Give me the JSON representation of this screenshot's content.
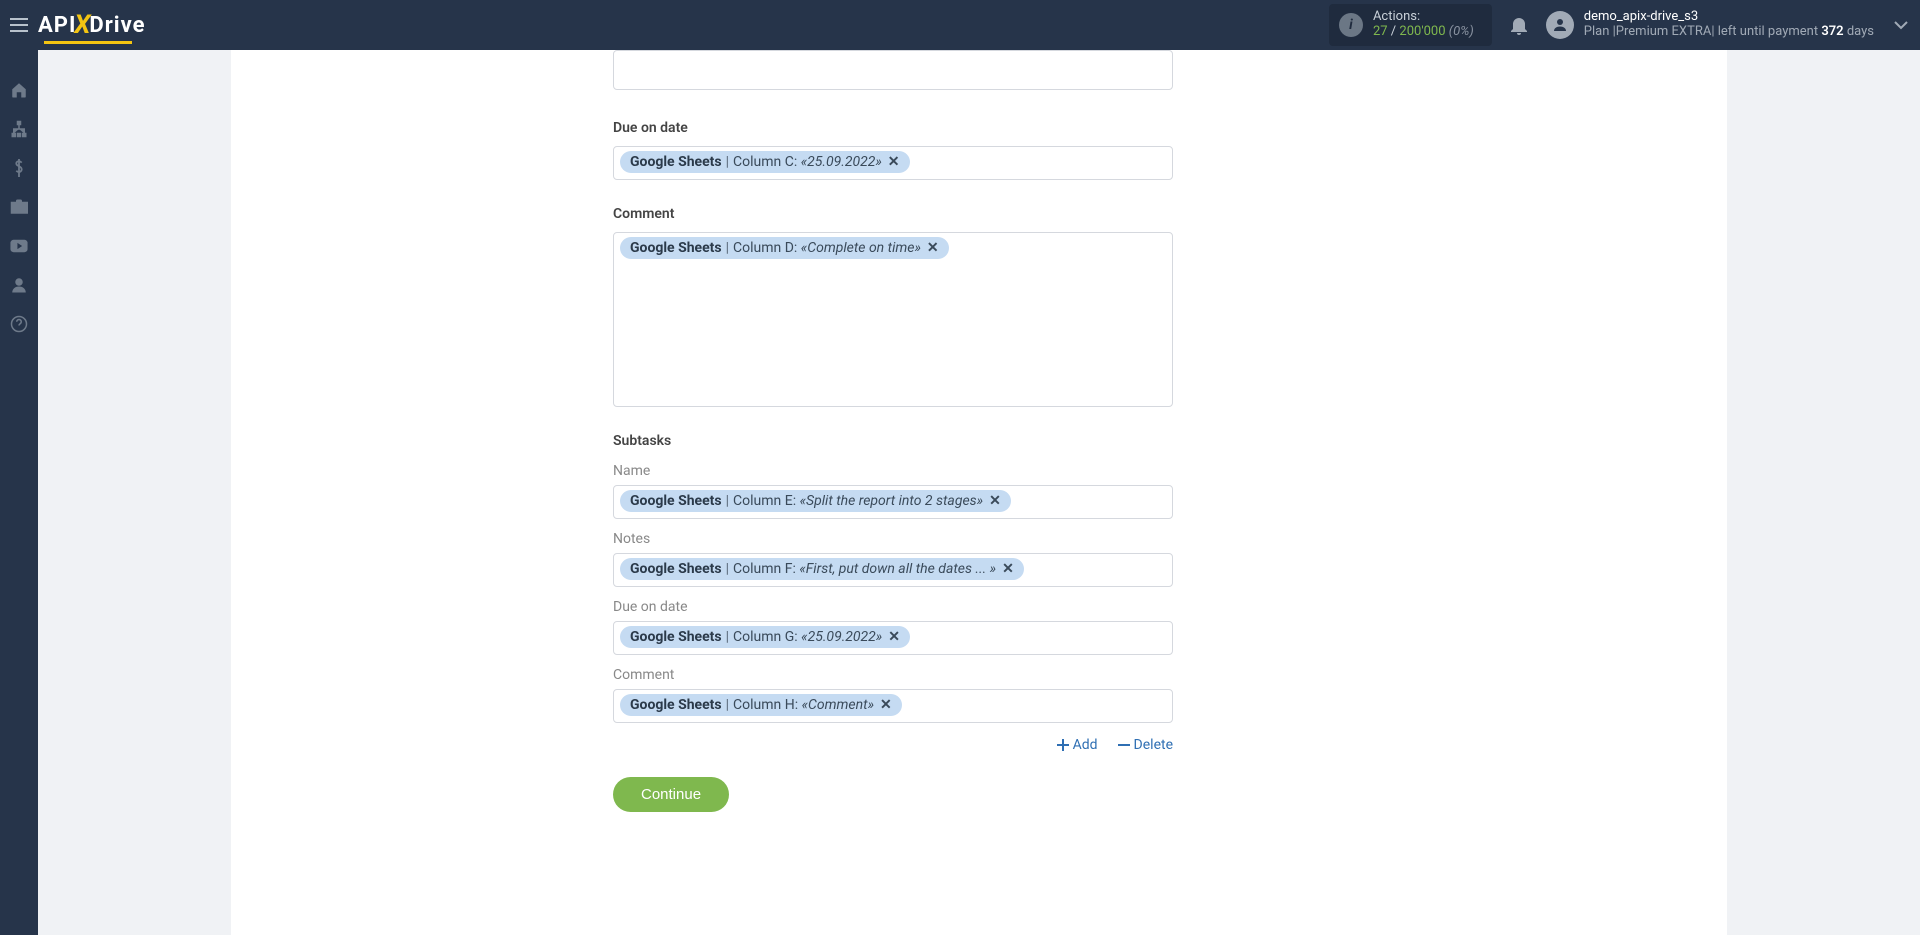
{
  "header": {
    "logo_left": "API",
    "logo_x": "X",
    "logo_right": "Drive",
    "actions_label": "Actions:",
    "actions_count": "27",
    "actions_of": " / ",
    "actions_limit": "200'000",
    "actions_pct": "(0%)",
    "user_name": "demo_apix-drive_s3",
    "plan_prefix": "Plan |",
    "plan_name": "Premium EXTRA",
    "plan_mid": "| left until payment ",
    "plan_days": "372",
    "plan_suffix": " days"
  },
  "fields": {
    "due_on_date": {
      "label": "Due on date",
      "tag": {
        "source": "Google Sheets",
        "column": "Column C:",
        "sample": "«25.09.2022»"
      }
    },
    "comment": {
      "label": "Comment",
      "tag": {
        "source": "Google Sheets",
        "column": "Column D:",
        "sample": "«Complete on time»"
      }
    },
    "subtasks_header": "Subtasks",
    "sub_name": {
      "label": "Name",
      "tag": {
        "source": "Google Sheets",
        "column": "Column E:",
        "sample": "«Split the report into 2 stages»"
      }
    },
    "sub_notes": {
      "label": "Notes",
      "tag": {
        "source": "Google Sheets",
        "column": "Column F:",
        "sample": "«First, put down all the dates ... »"
      }
    },
    "sub_due": {
      "label": "Due on date",
      "tag": {
        "source": "Google Sheets",
        "column": "Column G:",
        "sample": "«25.09.2022»"
      }
    },
    "sub_comment": {
      "label": "Comment",
      "tag": {
        "source": "Google Sheets",
        "column": "Column H:",
        "sample": "«Comment»"
      }
    }
  },
  "actions": {
    "add": "Add",
    "delete": "Delete"
  },
  "buttons": {
    "continue": "Continue"
  }
}
